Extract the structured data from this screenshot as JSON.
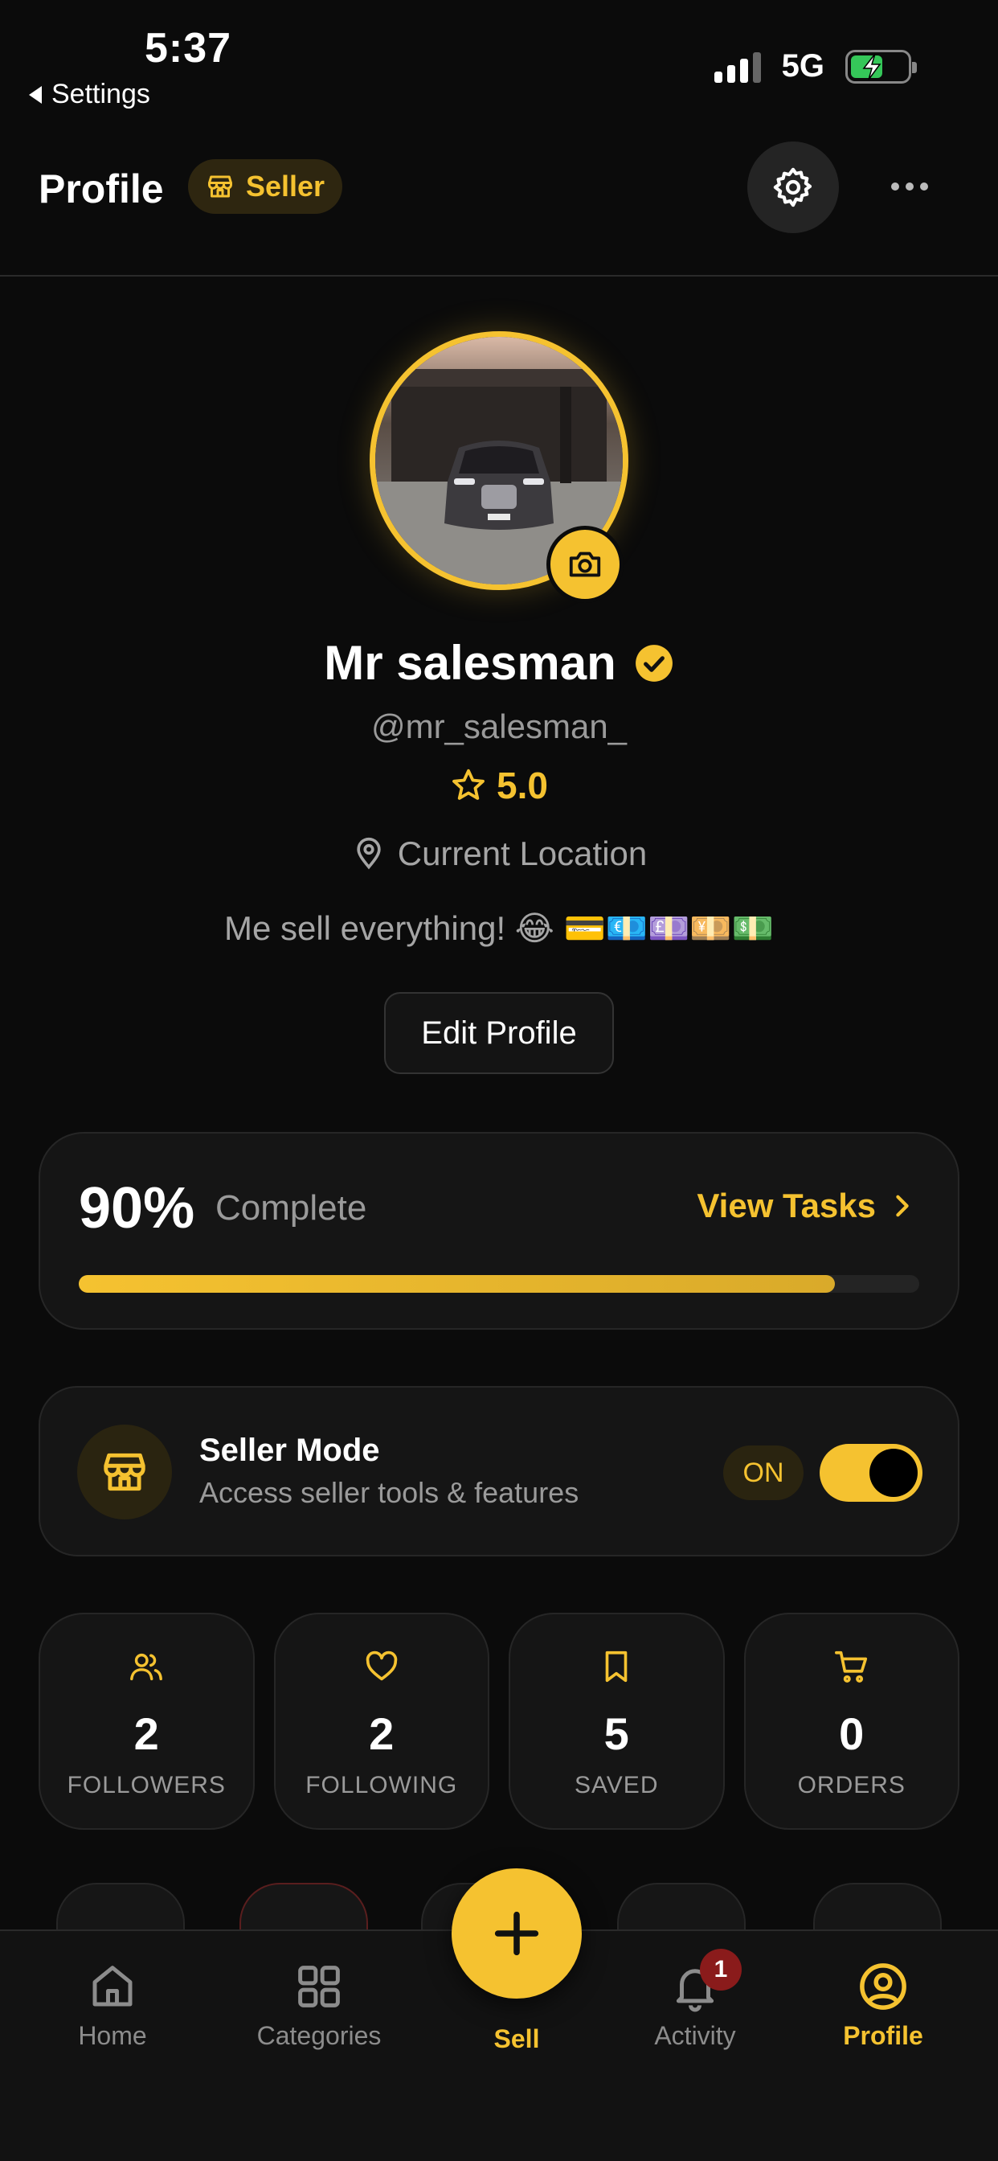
{
  "status_bar": {
    "time": "5:37",
    "back_label": "Settings",
    "network": "5G",
    "battery_level": 0.55
  },
  "header": {
    "title": "Profile",
    "role_badge": "Seller"
  },
  "profile": {
    "name": "Mr salesman",
    "handle": "@mr_salesman_",
    "rating": "5.0",
    "location": "Current Location",
    "bio": "Me sell everything! 😂 💳💶💷💴💵",
    "edit_label": "Edit Profile"
  },
  "completion": {
    "percent_label": "90%",
    "label": "Complete",
    "link": "View Tasks",
    "progress": 0.9
  },
  "seller_mode": {
    "title": "Seller Mode",
    "subtitle": "Access seller tools & features",
    "state_label": "ON",
    "enabled": true
  },
  "stats": [
    {
      "icon": "users-icon",
      "value": "2",
      "label": "FOLLOWERS"
    },
    {
      "icon": "heart-icon",
      "value": "2",
      "label": "FOLLOWING"
    },
    {
      "icon": "bookmark-icon",
      "value": "5",
      "label": "SAVED"
    },
    {
      "icon": "cart-icon",
      "value": "0",
      "label": "ORDERS"
    }
  ],
  "tabbar": {
    "home": "Home",
    "categories": "Categories",
    "sell": "Sell",
    "activity": "Activity",
    "activity_badge": "1",
    "profile": "Profile"
  },
  "colors": {
    "accent": "#f5c230",
    "background": "#0b0b0b",
    "card": "#151515"
  }
}
